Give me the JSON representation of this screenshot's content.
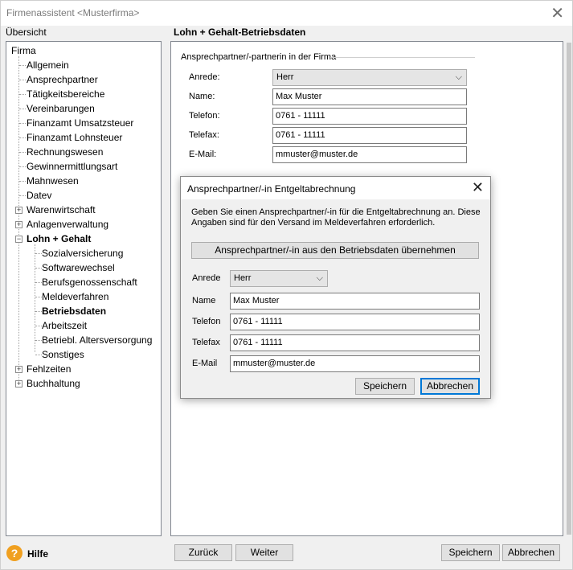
{
  "window": {
    "title": "Firmenassistent <Musterfirma>",
    "close_icon": "close-icon"
  },
  "tree": {
    "header": "Übersicht",
    "items": [
      {
        "label": "Firma",
        "bold": false
      },
      {
        "label": "Allgemein"
      },
      {
        "label": "Ansprechpartner"
      },
      {
        "label": "Tätigkeitsbereiche"
      },
      {
        "label": "Vereinbarungen"
      },
      {
        "label": "Finanzamt Umsatzsteuer"
      },
      {
        "label": "Finanzamt Lohnsteuer"
      },
      {
        "label": "Rechnungswesen"
      },
      {
        "label": "Gewinnermittlungsart"
      },
      {
        "label": "Mahnwesen"
      },
      {
        "label": "Datev"
      },
      {
        "label": "Warenwirtschaft"
      },
      {
        "label": "Anlagenverwaltung"
      },
      {
        "label": "Lohn + Gehalt"
      },
      {
        "label": "Sozialversicherung"
      },
      {
        "label": "Softwarewechsel"
      },
      {
        "label": "Berufsgenossenschaft"
      },
      {
        "label": "Meldeverfahren"
      },
      {
        "label": "Betriebsdaten"
      },
      {
        "label": "Arbeitszeit"
      },
      {
        "label": "Betriebl. Altersversorgung"
      },
      {
        "label": "Sonstiges"
      },
      {
        "label": "Fehlzeiten"
      },
      {
        "label": "Buchhaltung"
      }
    ]
  },
  "main": {
    "title": "Lohn + Gehalt-Betriebsdaten",
    "group_label": "Ansprechpartner/-partnerin in der Firma",
    "form": {
      "anrede_label": "Anrede:",
      "anrede_value": "Herr",
      "name_label": "Name:",
      "name_value": "Max Muster",
      "telefon_label": "Telefon:",
      "telefon_value": "0761 - 11111",
      "telefax_label": "Telefax:",
      "telefax_value": "0761 - 11111",
      "email_label": "E-Mail:",
      "email_value": "mmuster@muster.de"
    }
  },
  "dialog": {
    "title": "Ansprechpartner/-in Entgeltabrechnung",
    "description": "Geben Sie einen Ansprechpartner/-in für die Entgeltabrechnung an. Diese Angaben sind für den Versand im Meldeverfahren erforderlich.",
    "copy_button": "Ansprechpartner/-in aus den Betriebsdaten übernehmen",
    "anrede_label": "Anrede",
    "anrede_value": "Herr",
    "name_label": "Name",
    "name_value": "Max Muster",
    "telefon_label": "Telefon",
    "telefon_value": "0761 - 11111",
    "telefax_label": "Telefax",
    "telefax_value": "0761 - 11111",
    "email_label": "E-Mail",
    "email_value": "mmuster@muster.de",
    "save_button": "Speichern",
    "cancel_button": "Abbrechen"
  },
  "footer": {
    "help_label": "Hilfe",
    "back_button": "Zurück",
    "next_button": "Weiter",
    "save_button": "Speichern",
    "cancel_button": "Abbrechen"
  }
}
